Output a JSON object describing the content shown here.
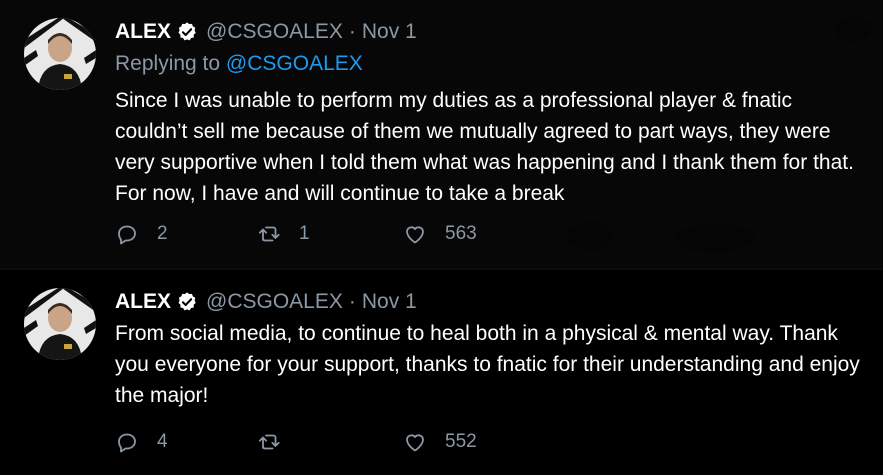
{
  "colors": {
    "background": "#000000",
    "text": "#ffffff",
    "muted": "#8b98a5",
    "link": "#1d9bf0",
    "verified_badge": "#ffffff"
  },
  "tweets": [
    {
      "display_name": "ALEX",
      "handle": "@CSGOALEX",
      "separator": "·",
      "date": "Nov 1",
      "replying_prefix": "Replying to",
      "replying_to": "@CSGOALEX",
      "text": "Since I was unable to perform my duties as a professional player & fnatic couldn’t sell me because of them we mutually agreed to part ways, they were very supportive when I told them what was happening and I thank them for that. For now, I have and will continue to take a break",
      "reply_count": "2",
      "retweet_count": "1",
      "like_count": "563",
      "icons": [
        "reply-icon",
        "retweet-icon",
        "like-icon"
      ]
    },
    {
      "display_name": "ALEX",
      "handle": "@CSGOALEX",
      "separator": "·",
      "date": "Nov 1",
      "text": "From social media, to continue to heal both in a physical & mental way. Thank you everyone for your support, thanks to fnatic for their understanding and enjoy the major!",
      "reply_count": "4",
      "retweet_count": "",
      "like_count": "552",
      "icons": [
        "reply-icon",
        "retweet-icon",
        "like-icon"
      ]
    }
  ]
}
